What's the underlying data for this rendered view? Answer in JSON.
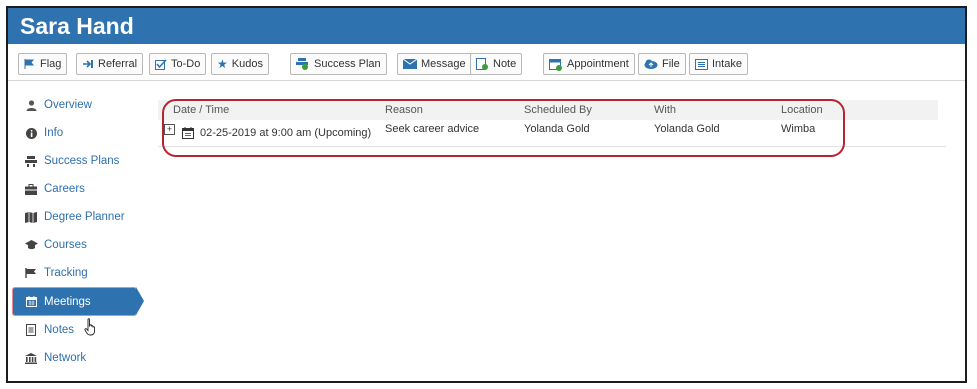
{
  "header": {
    "title": "Sara Hand"
  },
  "toolbar": {
    "flag": "Flag",
    "referral": "Referral",
    "todo": "To-Do",
    "kudos": "Kudos",
    "success_plan": "Success Plan",
    "message": "Message",
    "note": "Note",
    "appointment": "Appointment",
    "file": "File",
    "intake": "Intake"
  },
  "sidebar": {
    "items": [
      {
        "label": "Overview",
        "icon": "person-icon"
      },
      {
        "label": "Info",
        "icon": "info-icon"
      },
      {
        "label": "Success Plans",
        "icon": "success-plans-icon"
      },
      {
        "label": "Careers",
        "icon": "briefcase-icon"
      },
      {
        "label": "Degree Planner",
        "icon": "map-icon"
      },
      {
        "label": "Courses",
        "icon": "graduation-cap-icon"
      },
      {
        "label": "Tracking",
        "icon": "flag-icon"
      },
      {
        "label": "Meetings",
        "icon": "calendar-icon",
        "active": true
      },
      {
        "label": "Notes",
        "icon": "note-icon"
      },
      {
        "label": "Network",
        "icon": "institution-icon"
      }
    ]
  },
  "meetings": {
    "columns": [
      "Date / Time",
      "Reason",
      "Scheduled By",
      "With",
      "Location"
    ],
    "rows": [
      {
        "date_time": "02-25-2019 at 9:00 am (Upcoming)",
        "reason": "Seek career advice",
        "scheduled_by": "Yolanda Gold",
        "with": "Yolanda Gold",
        "location": "Wimba",
        "expander": "+"
      }
    ]
  },
  "colors": {
    "brand": "#2e73b0",
    "highlight": "#b3252f"
  }
}
